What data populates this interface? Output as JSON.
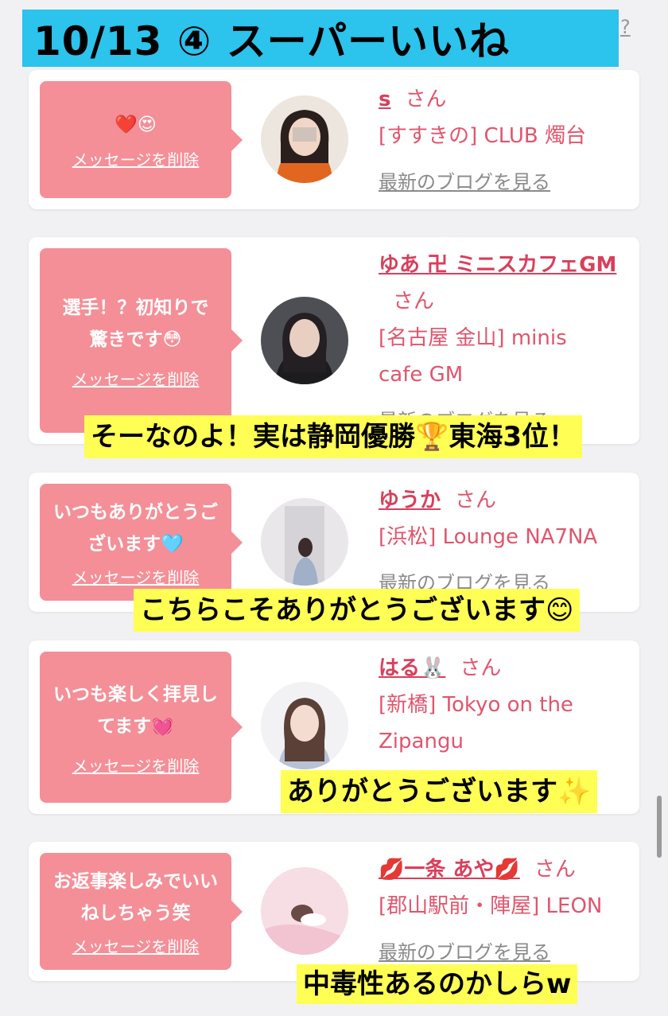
{
  "header": {
    "title": "10/13 ④ スーパーいいね",
    "help": "?"
  },
  "cards": [
    {
      "message": "❤️😍",
      "delete_label": "メッセージを削除",
      "name": "s",
      "honorific": "さん",
      "shop": "[すすきの] CLUB 燭台",
      "blog_label": "最新のブログを見る"
    },
    {
      "message": "選手！？初知りで驚きです😳",
      "delete_label": "メッセージを削除",
      "name": "ゆあ 卍 ミニスカフェGM",
      "honorific": "さん",
      "shop": "[名古屋 金山] minis cafe GM",
      "blog_label": "最新のブログを見る"
    },
    {
      "message": "いつもありがとうございます🩵",
      "delete_label": "メッセージを削除",
      "name": "ゆうか",
      "honorific": "さん",
      "shop": "[浜松] Lounge NA7NA",
      "blog_label": "最新のブログを見る"
    },
    {
      "message": "いつも楽しく拝見してます💓",
      "delete_label": "メッセージを削除",
      "name": "はる🐰",
      "honorific": "さん",
      "shop": "[新橋] Tokyo on the Zipangu",
      "blog_label": ""
    },
    {
      "message": "お返事楽しみでいいねしちゃう笑",
      "delete_label": "メッセージを削除",
      "name": "💋一条 あや💋",
      "honorific": "さん",
      "shop": "[郡山駅前・陣屋] LEON",
      "blog_label": "最新のブログを見る"
    }
  ],
  "captions": [
    "そーなのよ！実は静岡優勝🏆東海3位！",
    "こちらこそありがとうございます😊",
    "ありがとうございます✨",
    "中毒性あるのかしらw"
  ],
  "colors": {
    "title_bg": "#2cc3ec",
    "message_bg": "#f48f97",
    "name_color": "#d93f5b",
    "caption_bg": "#fffe54"
  }
}
